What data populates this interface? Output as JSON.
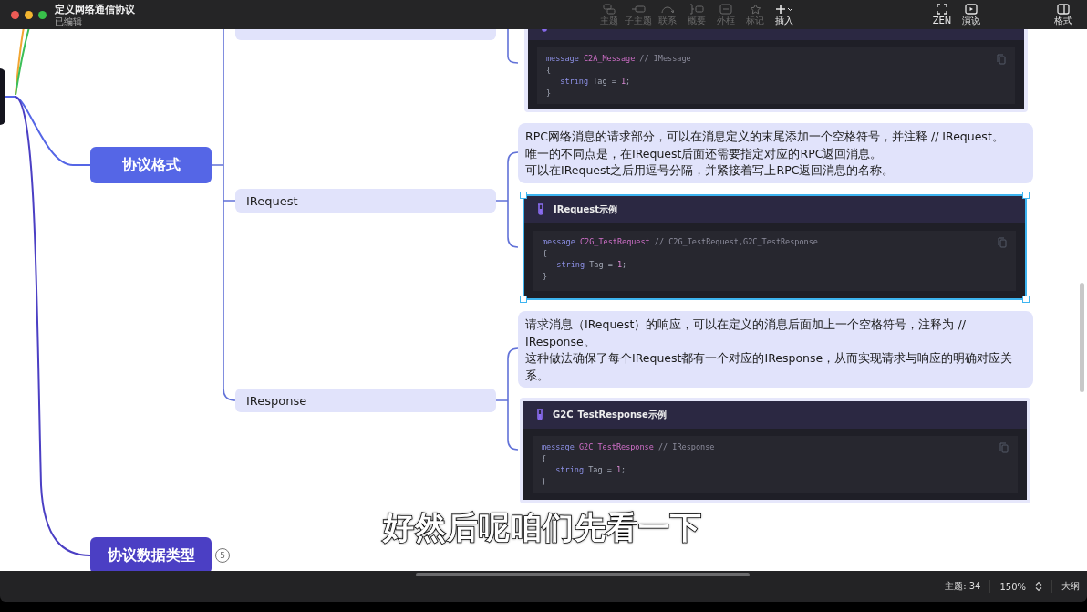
{
  "window": {
    "title": "定义网络通信协议",
    "subtitle": "已编辑"
  },
  "toolbar": [
    {
      "kind": "topic",
      "label": "主题",
      "disabled": true
    },
    {
      "kind": "subtopic",
      "label": "子主题",
      "disabled": true
    },
    {
      "kind": "relation",
      "label": "联系",
      "disabled": true
    },
    {
      "kind": "summary",
      "label": "概要",
      "disabled": true
    },
    {
      "kind": "boundary",
      "label": "外框",
      "disabled": true
    },
    {
      "kind": "marker",
      "label": "标记",
      "disabled": true
    },
    {
      "kind": "insert",
      "label": "插入",
      "disabled": false
    }
  ],
  "right_toolbar": [
    {
      "kind": "zen",
      "label": "ZEN"
    },
    {
      "kind": "present",
      "label": "演说"
    },
    {
      "kind": "format",
      "label": "格式"
    }
  ],
  "mindmap": {
    "main_topics": [
      {
        "label": "协议格式",
        "color": "#5566e6"
      },
      {
        "label": "协议数据类型",
        "color": "#4b3fc4",
        "badge": "5"
      }
    ],
    "subtopics": [
      {
        "notes": [
          {
            "kind": "code",
            "selected": false,
            "code": [
              [
                {
                  "kind": "keyword",
                  "text": "message "
                },
                {
                  "kind": "name",
                  "text": "C2A_Message"
                },
                {
                  "kind": "comment",
                  "text": " // IMessage"
                }
              ],
              [
                {
                  "kind": "plain",
                  "text": "{"
                }
              ],
              [
                {
                  "kind": "keyword",
                  "text": "   string "
                },
                {
                  "kind": "plain",
                  "text": "Tag = "
                },
                {
                  "kind": "number",
                  "text": "1"
                },
                {
                  "kind": "plain",
                  "text": ";"
                }
              ],
              [
                {
                  "kind": "plain",
                  "text": "}"
                }
              ]
            ]
          }
        ]
      },
      {
        "label": "IRequest",
        "notes": [
          {
            "kind": "text",
            "paragraphs": [
              "RPC网络消息的请求部分，可以在消息定义的末尾添加一个空格符号，并注释 // IRequest。",
              "唯一的不同点是，在IRequest后面还需要指定对应的RPC返回消息。",
              "可以在IRequest之后用逗号分隔，并紧接着写上RPC返回消息的名称。"
            ]
          },
          {
            "kind": "code",
            "title": "IRequest示例",
            "selected": true,
            "code": [
              [
                {
                  "kind": "keyword",
                  "text": "message "
                },
                {
                  "kind": "name",
                  "text": "C2G_TestRequest"
                },
                {
                  "kind": "comment",
                  "text": " // C2G_TestRequest,G2C_TestResponse"
                }
              ],
              [
                {
                  "kind": "plain",
                  "text": "{"
                }
              ],
              [
                {
                  "kind": "keyword",
                  "text": "   string "
                },
                {
                  "kind": "plain",
                  "text": "Tag = "
                },
                {
                  "kind": "number",
                  "text": "1"
                },
                {
                  "kind": "plain",
                  "text": ";"
                }
              ],
              [
                {
                  "kind": "plain",
                  "text": "}"
                }
              ]
            ]
          }
        ]
      },
      {
        "label": "IResponse",
        "notes": [
          {
            "kind": "text",
            "paragraphs": [
              "请求消息（IRequest）的响应，可以在定义的消息后面加上一个空格符号，注释为 // IResponse。",
              "这种做法确保了每个IRequest都有一个对应的IResponse，从而实现请求与响应的明确对应关系。"
            ]
          },
          {
            "kind": "code",
            "title": "G2C_TestResponse示例",
            "selected": false,
            "code": [
              [
                {
                  "kind": "keyword",
                  "text": "message "
                },
                {
                  "kind": "name",
                  "text": "G2C_TestResponse"
                },
                {
                  "kind": "comment",
                  "text": " // IResponse"
                }
              ],
              [
                {
                  "kind": "plain",
                  "text": "{"
                }
              ],
              [
                {
                  "kind": "keyword",
                  "text": "   string "
                },
                {
                  "kind": "plain",
                  "text": "Tag = "
                },
                {
                  "kind": "number",
                  "text": "1"
                },
                {
                  "kind": "plain",
                  "text": ";"
                }
              ],
              [
                {
                  "kind": "plain",
                  "text": "}"
                }
              ]
            ]
          }
        ]
      }
    ]
  },
  "subtitle": "好然后呢咱们先看一下",
  "status_bar": {
    "topics": "主题: 34",
    "zoom": "150%",
    "outline": "大纲"
  }
}
